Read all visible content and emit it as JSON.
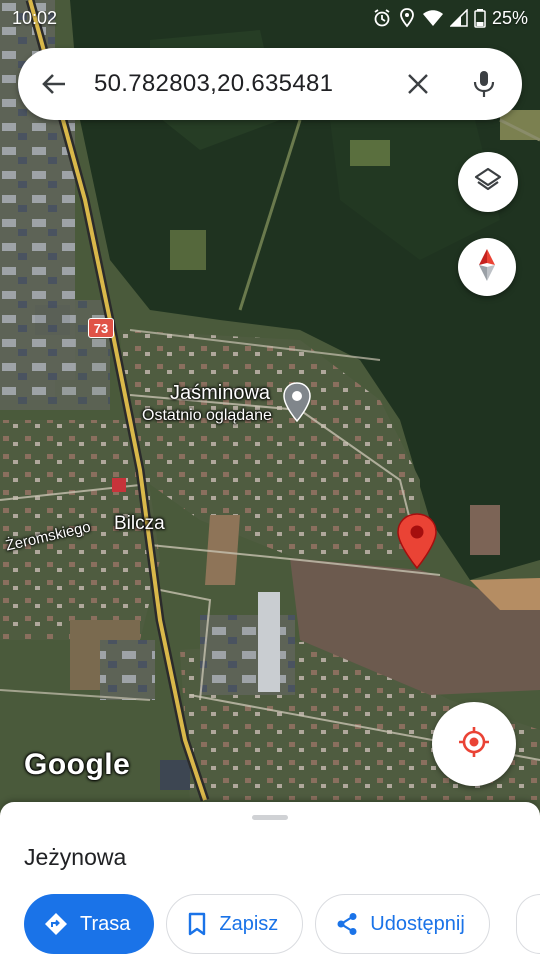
{
  "status_bar": {
    "time": "10:02",
    "battery": "25%"
  },
  "search": {
    "query": "50.782803,20.635481"
  },
  "map": {
    "place_pin_title": "Jaśminowa",
    "place_pin_subtitle": "Ostatnio oglądane",
    "village_label": "Bilcza",
    "street_label": "Żeromskiego",
    "route_number": "73",
    "logo": "Google"
  },
  "sheet": {
    "place_name": "Jeżynowa",
    "actions": [
      {
        "label": "Trasa",
        "icon": "directions-icon"
      },
      {
        "label": "Zapisz",
        "icon": "bookmark-icon"
      },
      {
        "label": "Udostępnij",
        "icon": "share-icon"
      }
    ]
  },
  "colors": {
    "accent": "#1a73e8",
    "pin": "#ea4335"
  }
}
